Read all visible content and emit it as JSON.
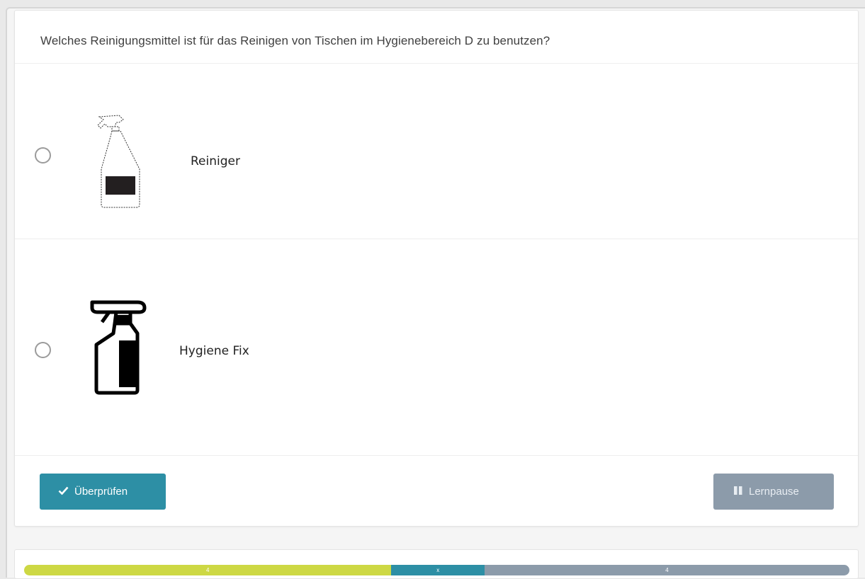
{
  "question": {
    "text": "Welches Reinigungsmittel ist für das Reinigen von Tischen im Hygienebereich D zu benutzen?"
  },
  "options": [
    {
      "label": "Reiniger",
      "icon": "spray-bottle-outline-icon",
      "selected": false
    },
    {
      "label": "Hygiene Fix",
      "icon": "spray-bottle-solid-icon",
      "selected": false
    }
  ],
  "footer": {
    "check_label": "Überprüfen",
    "check_icon": "checkmark-icon",
    "pause_label": "Lernpause",
    "pause_icon": "pause-icon"
  },
  "progress": {
    "segments": [
      {
        "label": "4",
        "fraction": 0.445,
        "color": "#cdd844"
      },
      {
        "label": "x",
        "fraction": 0.113,
        "color": "#2d8fa5"
      },
      {
        "label": "4",
        "fraction": 0.442,
        "color": "#8c9baa"
      }
    ]
  },
  "colors": {
    "primary": "#2d8fa5",
    "secondary": "#8c9baa",
    "progress_done": "#cdd844"
  }
}
